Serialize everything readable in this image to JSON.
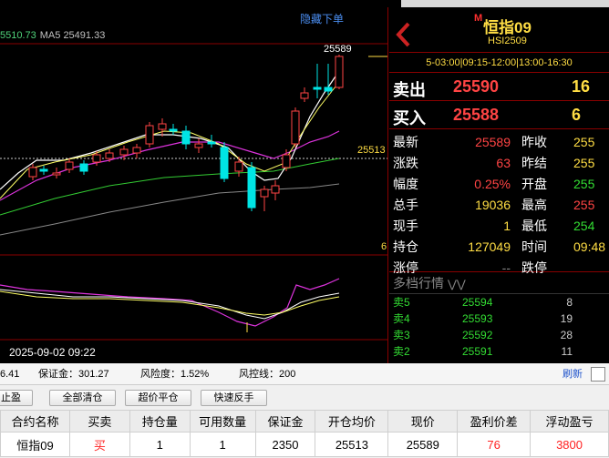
{
  "chart": {
    "hide_order_label": "隐藏下单",
    "ma_label_1": "5510.73",
    "ma_label_2": "MA5 25491.33",
    "high_label": "25589",
    "last_price_label": "25513",
    "right_tick": "6",
    "timestamp": "2025-09-02 09:22"
  },
  "quote": {
    "badge": "M",
    "title": "恒指09",
    "code": "HSI2509",
    "session": "5-03:00|09:15-12:00|13:00-16:30",
    "ask": {
      "label": "卖出",
      "price": "25590",
      "volume": "16"
    },
    "bid": {
      "label": "买入",
      "price": "25588",
      "volume": "6"
    },
    "stats": [
      {
        "l1": "最新",
        "v1": "25589",
        "c1": "red",
        "l2": "昨收",
        "v2": "255"
      },
      {
        "l1": "涨跌",
        "v1": "63",
        "c1": "red",
        "l2": "昨结",
        "v2": "255"
      },
      {
        "l1": "幅度",
        "v1": "0.25%",
        "c1": "red",
        "l2": "开盘",
        "v2": "255"
      },
      {
        "l1": "总手",
        "v1": "19036",
        "c1": "yellow",
        "l2": "最高",
        "v2": "255"
      },
      {
        "l1": "现手",
        "v1": "1",
        "c1": "yellow",
        "l2": "最低",
        "v2": "254"
      },
      {
        "l1": "持仓",
        "v1": "127049",
        "c1": "yellow",
        "l2": "时间",
        "v2": "09:48"
      },
      {
        "l1": "涨停",
        "v1": "--",
        "c1": "gray",
        "l2": "跌停",
        "v2": ""
      }
    ],
    "depth_title": "多档行情",
    "depth": [
      {
        "label": "卖5",
        "price": "25594",
        "vol": "8"
      },
      {
        "label": "卖4",
        "price": "25593",
        "vol": "19"
      },
      {
        "label": "卖3",
        "price": "25592",
        "vol": "28"
      },
      {
        "label": "卖2",
        "price": "25591",
        "vol": "11"
      }
    ]
  },
  "account": {
    "first_value": "6.41",
    "margin": "保证金：301.27",
    "risk": "风险度：1.52%",
    "risk_line": "风控线：200",
    "refresh": "刷新"
  },
  "toolbar": {
    "stop_label": "止盈",
    "close_all": "全部清仓",
    "super_close": "超价平仓",
    "reverse": "快速反手"
  },
  "positions": {
    "headers": [
      "合约名称",
      "买卖",
      "持仓量",
      "可用数量",
      "保证金",
      "开仓均价",
      "现价",
      "盈利价差",
      "浮动盈亏"
    ],
    "rows": [
      [
        "恒指09",
        "买",
        "1",
        "1",
        "2350",
        "25513",
        "25589",
        "76",
        "3800"
      ]
    ]
  },
  "colors": {
    "up": "#ff4444",
    "down": "#00e5e5",
    "accent": "#ffdd44",
    "border": "#8a0000"
  }
}
